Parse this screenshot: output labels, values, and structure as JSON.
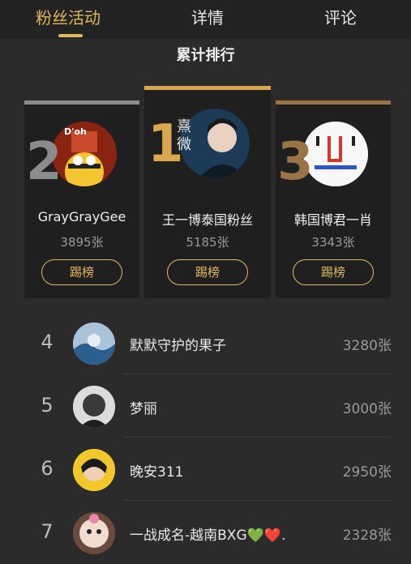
{
  "tabs": [
    {
      "label": "粉丝活动"
    },
    {
      "label": "详情"
    },
    {
      "label": "评论"
    }
  ],
  "section_title": "累计排行",
  "kick_label": "踢榜",
  "colors": {
    "accent": "#e0b95f",
    "silver": "#8c8c8c",
    "gold": "#d9a84e",
    "bronze": "#9b7446"
  },
  "podium": [
    {
      "rank": "1",
      "name": "王一博泰国粉丝",
      "count": "5185张",
      "avatar_text": "熹微"
    },
    {
      "rank": "2",
      "name": "GrayGrayGee",
      "count": "3895张",
      "avatar_text": "D'oh"
    },
    {
      "rank": "3",
      "name": "韩国博君一肖",
      "count": "3343张"
    }
  ],
  "list": [
    {
      "rank": "4",
      "name": "默默守护的果子",
      "count": "3280张"
    },
    {
      "rank": "5",
      "name": "梦丽",
      "count": "3000张"
    },
    {
      "rank": "6",
      "name": "晚安311",
      "count": "2950张"
    },
    {
      "rank": "7",
      "name": "一战成名-越南BXG💚❤️.",
      "count": "2328张"
    }
  ]
}
